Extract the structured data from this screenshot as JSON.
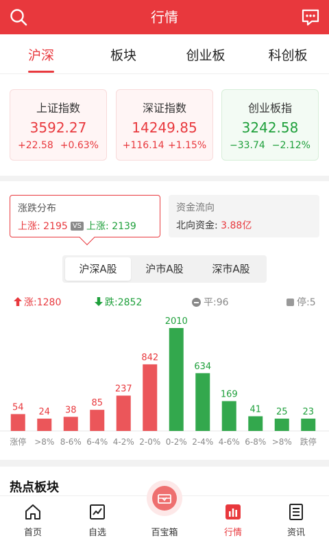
{
  "header": {
    "title": "行情"
  },
  "tabs": [
    {
      "label": "沪深",
      "active": true
    },
    {
      "label": "板块",
      "active": false
    },
    {
      "label": "创业板",
      "active": false
    },
    {
      "label": "科创板",
      "active": false
    }
  ],
  "indices": [
    {
      "name": "上证指数",
      "value": "3592.27",
      "change": "+22.58",
      "pct": "+0.63%",
      "trend": "up"
    },
    {
      "name": "深证指数",
      "value": "14249.85",
      "change": "+116.14",
      "pct": "+1.15%",
      "trend": "up"
    },
    {
      "name": "创业板指",
      "value": "3242.58",
      "change": "−33.74",
      "pct": "−2.12%",
      "trend": "down"
    }
  ],
  "distribution": {
    "label": "涨跌分布",
    "left_prefix": "上涨: ",
    "left_value": "2195",
    "vs": "VS",
    "right_prefix": "上涨: ",
    "right_value": "2139"
  },
  "fund_flow": {
    "label": "资金流向",
    "prefix": "北向资金: ",
    "value": "3.88亿"
  },
  "segment": [
    {
      "label": "沪深A股",
      "active": true
    },
    {
      "label": "沪市A股",
      "active": false
    },
    {
      "label": "深市A股",
      "active": false
    }
  ],
  "legend": {
    "up": "涨:1280",
    "down": "跌:2852",
    "flat": "平:96",
    "halt": "停:5"
  },
  "colors": {
    "red": "#e8383d",
    "green": "#1d9f3a",
    "gray": "#999999"
  },
  "chart_data": {
    "type": "bar",
    "categories": [
      "涨停",
      ">8%",
      "8-6%",
      "6-4%",
      "4-2%",
      "2-0%",
      "0-2%",
      "2-4%",
      "4-6%",
      "6-8%",
      ">8%",
      "跌停"
    ],
    "values": [
      54,
      24,
      38,
      85,
      237,
      842,
      2010,
      634,
      169,
      41,
      25,
      23
    ],
    "directions": [
      "up",
      "up",
      "up",
      "up",
      "up",
      "up",
      "down",
      "down",
      "down",
      "down",
      "down",
      "down"
    ]
  },
  "hot_sectors": {
    "title": "热点板块"
  },
  "nav": [
    {
      "label": "首页",
      "icon": "home-icon",
      "active": false
    },
    {
      "label": "自选",
      "icon": "chart-icon",
      "active": false
    },
    {
      "label": "百宝箱",
      "icon": "treasure-icon",
      "active": false
    },
    {
      "label": "行情",
      "icon": "market-icon",
      "active": true
    },
    {
      "label": "资讯",
      "icon": "news-icon",
      "active": false
    }
  ]
}
